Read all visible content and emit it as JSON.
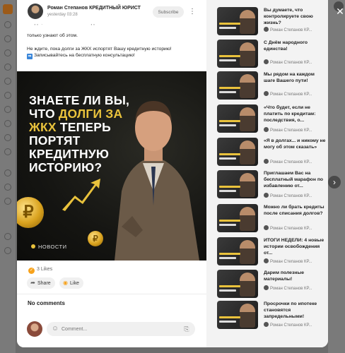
{
  "post": {
    "author": "Роман Степанов КРЕДИТНЫЙ ЮРИСТ",
    "date": "yesterday 03:28",
    "subscribe_label": "Subscribe",
    "text_cut": "ЛЮДИ, ОКОЛО ПОЛОВИНЫ ДОЛЖНИКОВ СМОГУТ ПОГАСИТЬ ЗАДОЛЖЕННОСТЬ, КАК",
    "text_line1": "только узнают об этом.",
    "text_line2": "Не ждите, пока долги за ЖКХ испортят Вашу кредитную историю!",
    "text_line3": "Записывайтесь на бесплатную консультацию!",
    "image": {
      "headline_1": "ЗНАЕТЕ ЛИ ВЫ, ЧТО ",
      "headline_2": "ДОЛГИ ЗА ЖКХ",
      "headline_3": " ТЕПЕРЬ ПОРТЯТ КРЕДИТНУЮ ИСТОРИЮ?",
      "news": "НОВОСТИ"
    },
    "likes": "3 Likes",
    "share_label": "Share",
    "like_label": "Like",
    "no_comments": "No comments",
    "comment_placeholder": "Comment..."
  },
  "sidebar": {
    "items": [
      {
        "title": "Вы думаете, что контролируете свою жизнь?",
        "author": "Роман Степанов КР..."
      },
      {
        "title": "С Днём народного единства!",
        "author": "Роман Степанов КР..."
      },
      {
        "title": "Мы рядом на каждом шаге Вашего пути!",
        "author": "Роман Степанов КР..."
      },
      {
        "title": "«Что будет, если не платить по кредитам: последствия, о...",
        "author": "Роман Степанов КР..."
      },
      {
        "title": "«Я в долгах... и никому не могу об этом сказать»",
        "author": "Роман Степанов КР..."
      },
      {
        "title": "Приглашаем Вас на бесплатный марафон по избавлению от...",
        "author": "Роман Степанов КР..."
      },
      {
        "title": "Можно ли брать кредиты после списания долгов?",
        "author": "Роман Степанов КР..."
      },
      {
        "title": "ИТОГИ НЕДЕЛИ: 4 новые истории освобождения от...",
        "author": "Роман Степанов КР..."
      },
      {
        "title": "Дарим полезные материалы!",
        "author": "Роман Степанов КР..."
      },
      {
        "title": "Просрочки по ипотеке становятся запредельными!",
        "author": "Роман Степанов КР..."
      }
    ]
  },
  "colors": {
    "accent": "#f7a21b",
    "gold": "#e9c23c"
  }
}
